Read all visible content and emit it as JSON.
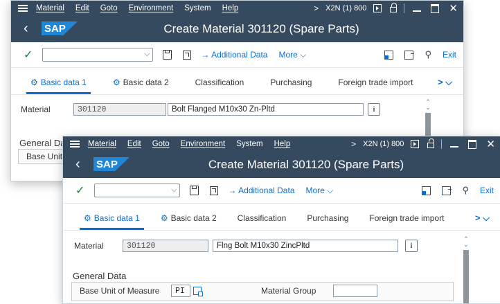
{
  "menu": {
    "items": [
      "Material",
      "Edit",
      "Goto",
      "Environment",
      "System",
      "Help"
    ],
    "system_info": "X2N (1) 800"
  },
  "back": {
    "title": "Create Material 301120 (Spare Parts)",
    "material_label": "Material",
    "material_number": "301120",
    "material_desc": "Bolt Flanged M10x30 Zn-Pltd",
    "general_data_partial": "General Da",
    "base_unit_partial": "Base Unit"
  },
  "front": {
    "title": "Create Material 301120 (Spare Parts)",
    "material_label": "Material",
    "material_number": "301120",
    "material_desc": "Flng Bolt M10x30 ZincPltd",
    "general_data": "General Data",
    "base_unit_label": "Base Unit of Measure",
    "base_unit_value": "PI",
    "material_group_label": "Material Group",
    "material_group_value": ""
  },
  "toolbar": {
    "additional_data": "→ Additional Data",
    "more": "More ⌵",
    "exit": "Exit"
  },
  "tabs": [
    "Basic data 1",
    "Basic data 2",
    "Classification",
    "Purchasing",
    "Foreign trade import"
  ],
  "tabs_nav": "> ⌵",
  "colors": {
    "shell": "#354a5f",
    "accent": "#0a6ed1",
    "sap_logo": "#1f87d6",
    "check": "#107e3e"
  }
}
